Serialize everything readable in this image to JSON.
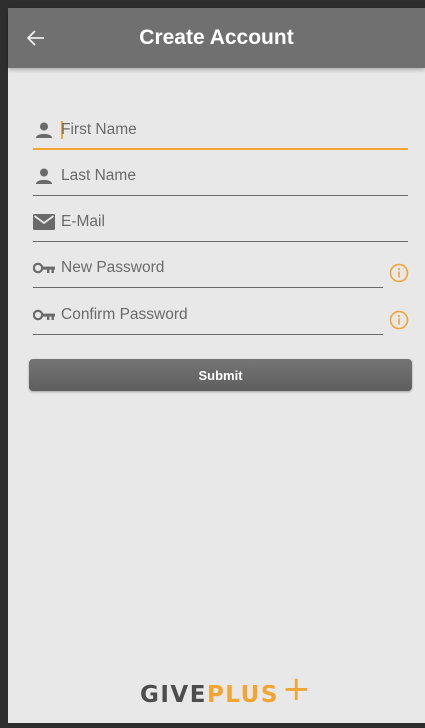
{
  "header": {
    "title": "Create Account",
    "back_icon": "arrow-left-icon"
  },
  "form": {
    "first_name": {
      "placeholder": "First Name",
      "value": "",
      "icon": "person-icon"
    },
    "last_name": {
      "placeholder": "Last Name",
      "value": "",
      "icon": "person-icon"
    },
    "email": {
      "placeholder": "E-Mail",
      "value": "",
      "icon": "mail-icon"
    },
    "new_password": {
      "placeholder": "New Password",
      "value": "",
      "icon": "key-icon",
      "info_icon": "info-icon"
    },
    "confirm_password": {
      "placeholder": "Confirm Password",
      "value": "",
      "icon": "key-icon",
      "info_icon": "info-icon"
    },
    "submit_label": "Submit"
  },
  "branding": {
    "logo_give": "GIVE",
    "logo_plus": "PLUS",
    "logo_cross": "+"
  },
  "colors": {
    "app_bar": "#707071",
    "accent": "#f2a533",
    "background": "#e8e8e8",
    "button": "#6a6a6b"
  }
}
